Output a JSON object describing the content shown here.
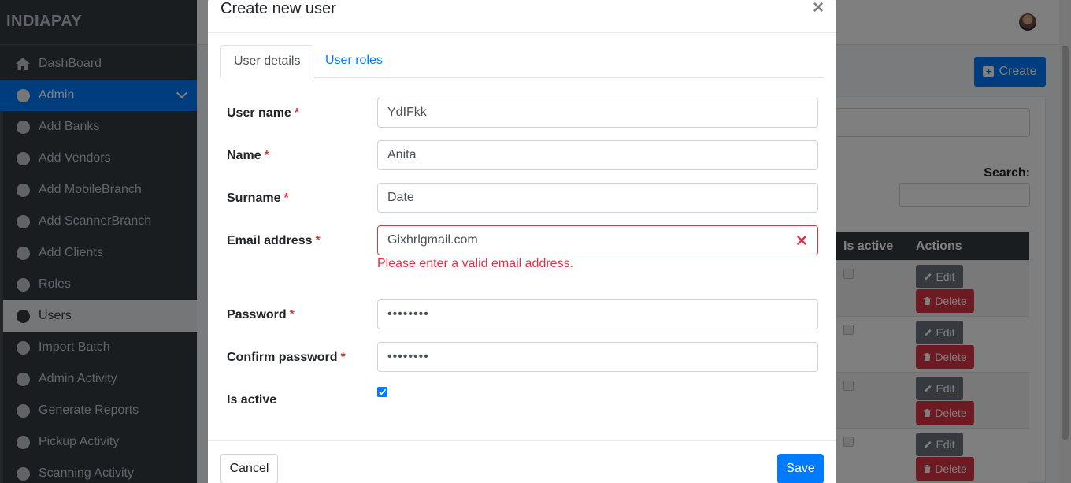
{
  "app": {
    "brand": "INDIAPAY"
  },
  "sidebar": {
    "items": [
      {
        "label": "DashBoard",
        "icon": "home-icon"
      },
      {
        "label": "Admin",
        "icon": "circle-icon"
      },
      {
        "label": "Add Banks",
        "icon": "circle-icon"
      },
      {
        "label": "Add Vendors",
        "icon": "circle-icon"
      },
      {
        "label": "Add MobileBranch",
        "icon": "circle-icon"
      },
      {
        "label": "Add ScannerBranch",
        "icon": "circle-icon"
      },
      {
        "label": "Add Clients",
        "icon": "circle-icon"
      },
      {
        "label": "Roles",
        "icon": "circle-icon"
      },
      {
        "label": "Users",
        "icon": "circle-icon"
      },
      {
        "label": "Import Batch",
        "icon": "circle-icon"
      },
      {
        "label": "Admin Activity",
        "icon": "circle-icon"
      },
      {
        "label": "Generate Reports",
        "icon": "circle-icon"
      },
      {
        "label": "Pickup Activity",
        "icon": "circle-icon"
      },
      {
        "label": "Scanning Activity",
        "icon": "circle-icon"
      }
    ]
  },
  "page": {
    "create_label": "Create",
    "search_label": "Search:",
    "table": {
      "headers": [
        "Is active",
        "Actions"
      ],
      "edit_label": "Edit",
      "delete_label": "Delete"
    }
  },
  "modal": {
    "title": "Create new user",
    "close": "×",
    "tabs": [
      "User details",
      "User roles"
    ],
    "fields": {
      "username": {
        "label": "User name",
        "value": "YdIFkk"
      },
      "name": {
        "label": "Name",
        "value": "Anita"
      },
      "surname": {
        "label": "Surname",
        "value": "Date"
      },
      "email": {
        "label": "Email address",
        "value": "Gixhrlgmail.com",
        "error": "Please enter a valid email address."
      },
      "password": {
        "label": "Password",
        "value": "••••••••"
      },
      "confirm_password": {
        "label": "Confirm password",
        "value": "••••••••"
      },
      "is_active": {
        "label": "Is active",
        "checked": true
      }
    },
    "required_marker": "*",
    "cancel_label": "Cancel",
    "save_label": "Save"
  },
  "colors": {
    "primary": "#007bff",
    "danger": "#dc3545",
    "sidebar_bg": "#343a40"
  }
}
